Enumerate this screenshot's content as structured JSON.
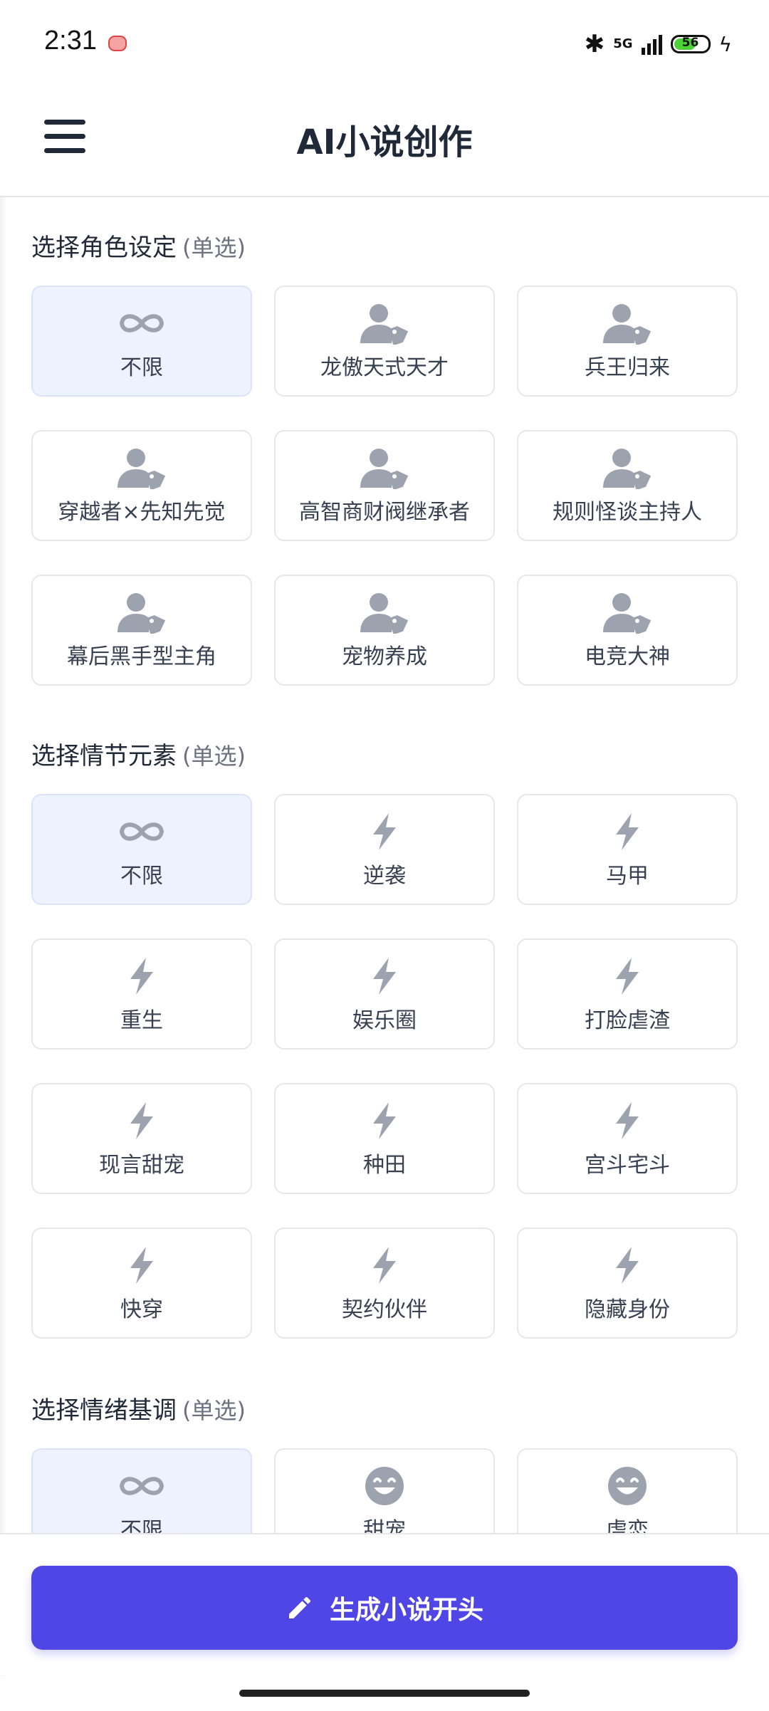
{
  "status_bar": {
    "time": "2:31",
    "network": "5G",
    "battery": "56",
    "icons": [
      "app-notification-icon",
      "bluetooth-icon",
      "signal-icon",
      "battery-icon",
      "charging-icon"
    ]
  },
  "app_bar": {
    "title": "AI小说创作",
    "menu_icon": "hamburger-menu-icon"
  },
  "sections": [
    {
      "title": "选择角色设定",
      "hint": "(单选)",
      "options": [
        {
          "label": "不限",
          "icon": "infinity-icon",
          "selected": true
        },
        {
          "label": "龙傲天式天才",
          "icon": "user-tag-icon",
          "selected": false
        },
        {
          "label": "兵王归来",
          "icon": "user-tag-icon",
          "selected": false
        },
        {
          "label": "穿越者×先知先觉",
          "icon": "user-tag-icon",
          "selected": false
        },
        {
          "label": "高智商财阀继承者",
          "icon": "user-tag-icon",
          "selected": false
        },
        {
          "label": "规则怪谈主持人",
          "icon": "user-tag-icon",
          "selected": false
        },
        {
          "label": "幕后黑手型主角",
          "icon": "user-tag-icon",
          "selected": false
        },
        {
          "label": "宠物养成",
          "icon": "user-tag-icon",
          "selected": false
        },
        {
          "label": "电竞大神",
          "icon": "user-tag-icon",
          "selected": false
        }
      ]
    },
    {
      "title": "选择情节元素",
      "hint": "(单选)",
      "options": [
        {
          "label": "不限",
          "icon": "infinity-icon",
          "selected": true
        },
        {
          "label": "逆袭",
          "icon": "lightning-icon",
          "selected": false
        },
        {
          "label": "马甲",
          "icon": "lightning-icon",
          "selected": false
        },
        {
          "label": "重生",
          "icon": "lightning-icon",
          "selected": false
        },
        {
          "label": "娱乐圈",
          "icon": "lightning-icon",
          "selected": false
        },
        {
          "label": "打脸虐渣",
          "icon": "lightning-icon",
          "selected": false
        },
        {
          "label": "现言甜宠",
          "icon": "lightning-icon",
          "selected": false
        },
        {
          "label": "种田",
          "icon": "lightning-icon",
          "selected": false
        },
        {
          "label": "宫斗宅斗",
          "icon": "lightning-icon",
          "selected": false
        },
        {
          "label": "快穿",
          "icon": "lightning-icon",
          "selected": false
        },
        {
          "label": "契约伙伴",
          "icon": "lightning-icon",
          "selected": false
        },
        {
          "label": "隐藏身份",
          "icon": "lightning-icon",
          "selected": false
        }
      ]
    },
    {
      "title": "选择情绪基调",
      "hint": "(单选)",
      "options": [
        {
          "label": "不限",
          "icon": "infinity-icon",
          "selected": true
        },
        {
          "label": "甜宠",
          "icon": "smile-icon",
          "selected": false
        },
        {
          "label": "虐恋",
          "icon": "smile-icon",
          "selected": false
        }
      ]
    }
  ],
  "bottom": {
    "generate_label": "生成小说开头",
    "generate_icon": "pencil-icon"
  },
  "colors": {
    "accent": "#4f46e5",
    "selected_bg": "#eef2ff",
    "icon_gray": "#9ca3af",
    "border": "#e5e7eb"
  }
}
